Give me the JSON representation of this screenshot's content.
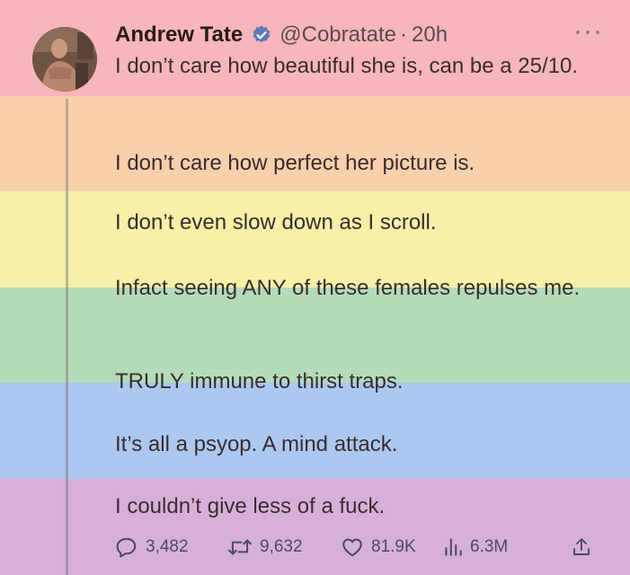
{
  "tweet": {
    "author": {
      "name": "Andrew Tate",
      "handle": "@Cobratate",
      "time": "20h",
      "verified_icon": "verified-badge-icon",
      "verified_color": "#1d9bf0"
    },
    "text_blocks": [
      "I don’t care how beautiful she is, can be a 25/10.",
      "I don’t care how perfect her picture is.",
      "I don’t even slow down as I scroll.",
      "Infact seeing ANY of these females repulses me.",
      "TRULY immune to thirst traps.",
      "It’s all a psyop. A mind attack.",
      "I couldn’t give less of a fuck."
    ],
    "metrics": {
      "replies": "3,482",
      "retweets": "9,632",
      "likes": "81.9K",
      "views": "6.3M"
    }
  },
  "background_bands": [
    "#f7b6bc",
    "#f8d0ab",
    "#f6f0a8",
    "#b4dbb8",
    "#acc8f1",
    "#d7b0da"
  ],
  "icons": [
    "more-options-icon",
    "reply-icon",
    "retweet-icon",
    "like-icon",
    "views-icon",
    "share-icon"
  ]
}
